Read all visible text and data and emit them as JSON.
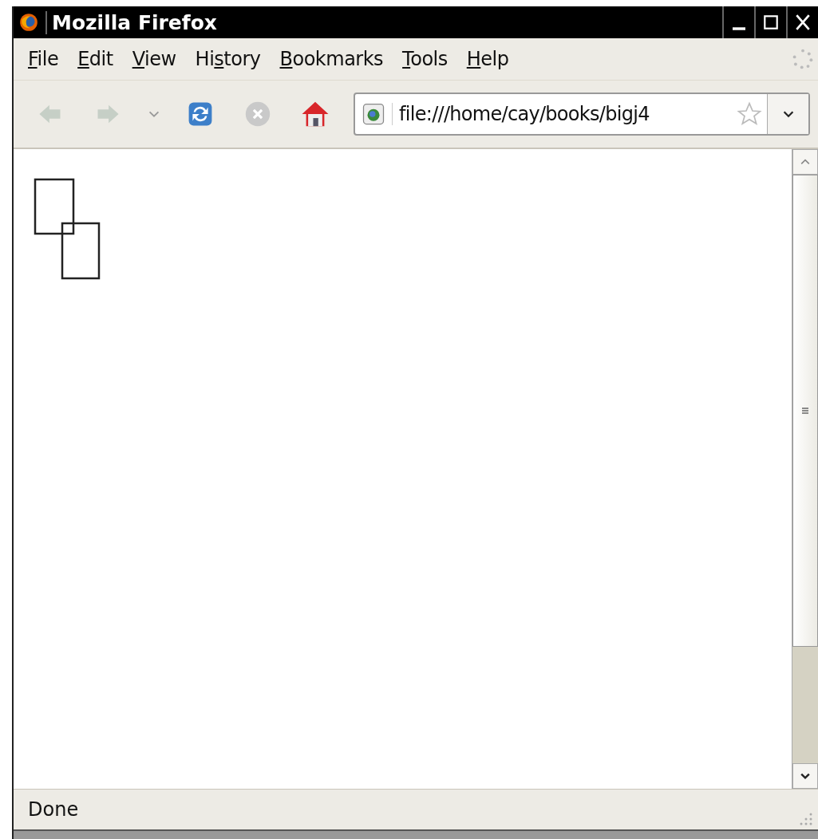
{
  "window": {
    "title": "Mozilla Firefox"
  },
  "menu": [
    {
      "key": "F",
      "rest": "ile"
    },
    {
      "key": "E",
      "rest": "dit"
    },
    {
      "key": "V",
      "rest": "iew"
    },
    {
      "prefix": "Hi",
      "key": "s",
      "rest": "tory"
    },
    {
      "key": "B",
      "rest": "ookmarks"
    },
    {
      "key": "T",
      "rest": "ools"
    },
    {
      "key": "H",
      "rest": "elp"
    }
  ],
  "toolbar": {
    "back_disabled": true,
    "forward_disabled": true,
    "stop_disabled": true,
    "address": "file:///home/cay/books/bigj4",
    "bookmarked": false
  },
  "page": {
    "shapes": [
      {
        "kind": "rectangle"
      },
      {
        "kind": "rectangle"
      }
    ]
  },
  "status_bar": {
    "text": "Done"
  }
}
